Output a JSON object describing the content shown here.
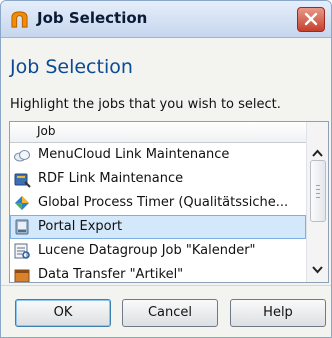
{
  "window": {
    "title": "Job Selection",
    "close_icon": "close-icon"
  },
  "heading": "Job Selection",
  "instruction": "Highlight the jobs that you wish to select.",
  "list": {
    "column_header": "Job",
    "items": [
      {
        "label": "MenuCloud Link Maintenance",
        "icon": "cloud-icon",
        "selected": false
      },
      {
        "label": "RDF Link Maintenance",
        "icon": "rdf-link-icon",
        "selected": false
      },
      {
        "label": "Global Process Timer (Qualitätssiche...",
        "icon": "process-timer-icon",
        "selected": false
      },
      {
        "label": "Portal Export",
        "icon": "portal-export-icon",
        "selected": true
      },
      {
        "label": "Lucene Datagroup Job \"Kalender\"",
        "icon": "lucene-icon",
        "selected": false
      },
      {
        "label": "Data Transfer \"Artikel\"",
        "icon": "data-transfer-icon",
        "selected": false
      }
    ]
  },
  "buttons": {
    "ok": "OK",
    "cancel": "Cancel",
    "help": "Help"
  },
  "colors": {
    "heading": "#0c4a93",
    "selection": "#d4e8fb",
    "close_button": "#c5402c"
  }
}
